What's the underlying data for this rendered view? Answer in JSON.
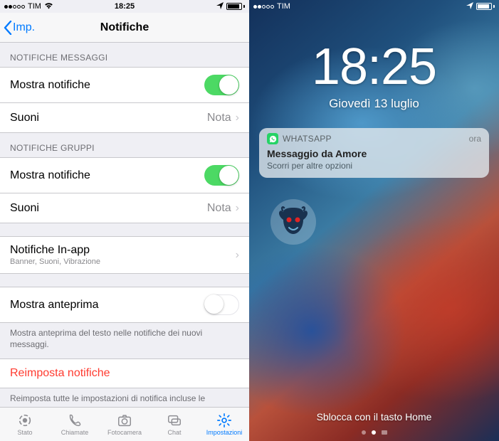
{
  "left": {
    "status": {
      "carrier": "TIM",
      "time": "18:25"
    },
    "nav": {
      "back": "Imp.",
      "title": "Notifiche"
    },
    "sections": {
      "messages_header": "NOTIFICHE MESSAGGI",
      "groups_header": "NOTIFICHE GRUPPI",
      "show_notifications": "Mostra notifiche",
      "sounds": "Suoni",
      "sounds_value": "Nota",
      "inapp": "Notifiche In-app",
      "inapp_sub": "Banner, Suoni, Vibrazione",
      "preview": "Mostra anteprima",
      "preview_footer": "Mostra anteprima del testo nelle notifiche dei nuovi messaggi.",
      "reset": "Reimposta notifiche",
      "reset_footer": "Reimposta tutte le impostazioni di notifica incluse le impostazioni personalizzate di notifica delle tue chat."
    },
    "tabs": {
      "status": "Stato",
      "calls": "Chiamate",
      "camera": "Fotocamera",
      "chat": "Chat",
      "settings": "Impostazioni"
    }
  },
  "right": {
    "status": {
      "carrier": "TIM"
    },
    "clock": {
      "time": "18:25",
      "date": "Giovedì 13 luglio"
    },
    "notification": {
      "app": "WHATSAPP",
      "time": "ora",
      "title": "Messaggio da Amore",
      "subtitle": "Scorri per altre opzioni"
    },
    "unlock": "Sblocca con il tasto Home"
  }
}
